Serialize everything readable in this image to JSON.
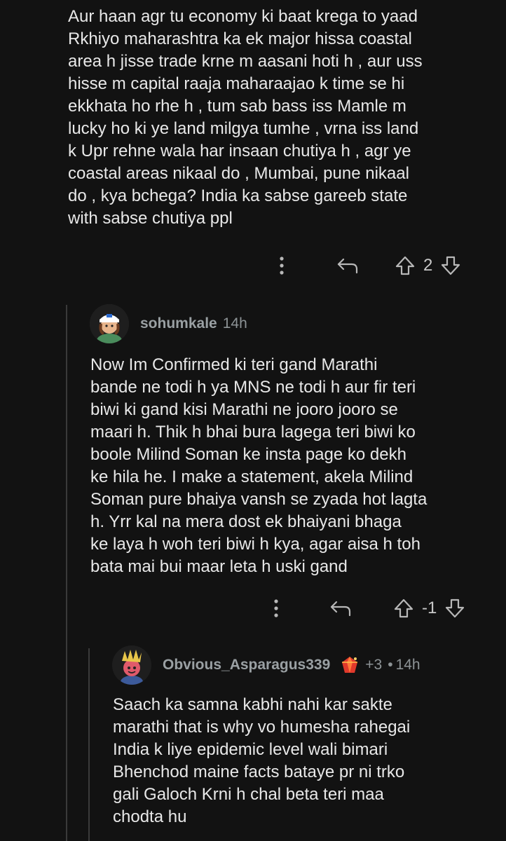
{
  "comments": [
    {
      "body": "Aur haan agr tu economy ki baat krega to yaad\nRkhiyo maharashtra ka ek major hissa coastal\narea h jisse trade krne m aasani hoti h , aur uss\nhisse m capital raaja maharaajao k time se hi\nekkhata ho rhe h , tum sab bass iss Mamle m\nlucky ho ki ye land milgya tumhe , vrna iss land\nk Upr rehne wala har insaan chutiya h , agr ye\ncoastal areas nikaal do , Mumbai, pune nikaal\ndo , kya bchega? India ka sabse gareeb state\nwith sabse chutiya ppl",
      "score": "2"
    },
    {
      "username": "sohumkale",
      "time": "14h",
      "body": "Now Im Confirmed ki teri gand Marathi\nbande ne todi h ya MNS ne todi h aur fir teri\nbiwi ki gand kisi Marathi ne jooro jooro se\nmaari h. Thik h bhai bura lagega teri biwi ko\nboole Milind Soman ke insta page ko dekh\nke hila he. I make a statement, akela Milind\nSoman pure bhaiya vansh se zyada hot lagta\nh. Yrr kal na mera dost ek bhaiyani bhaga\nke laya h woh teri biwi h kya, agar aisa h toh\nbata mai bui maar leta h uski gand",
      "score": "-1"
    },
    {
      "username": "Obvious_Asparagus339",
      "award_count": "+3",
      "separator": "•",
      "time": "14h",
      "body": "Saach ka samna kabhi nahi kar sakte\nmarathi that is why vo humesha rahegai\nIndia k liye epidemic level wali bimari\nBhenchod maine facts bataye pr ni trko\ngali Galoch Krni h chal beta teri maa\nchodta hu"
    }
  ],
  "icons": {
    "more": "more-vertical-icon",
    "reply": "reply-icon",
    "upvote": "upvote-arrow-icon",
    "downvote": "downvote-arrow-icon",
    "award": "award-gem-icon"
  },
  "colors": {
    "background": "#121212",
    "text": "#e8e8e8",
    "muted": "#8d9396",
    "thread_line": "#3a3a3a"
  }
}
